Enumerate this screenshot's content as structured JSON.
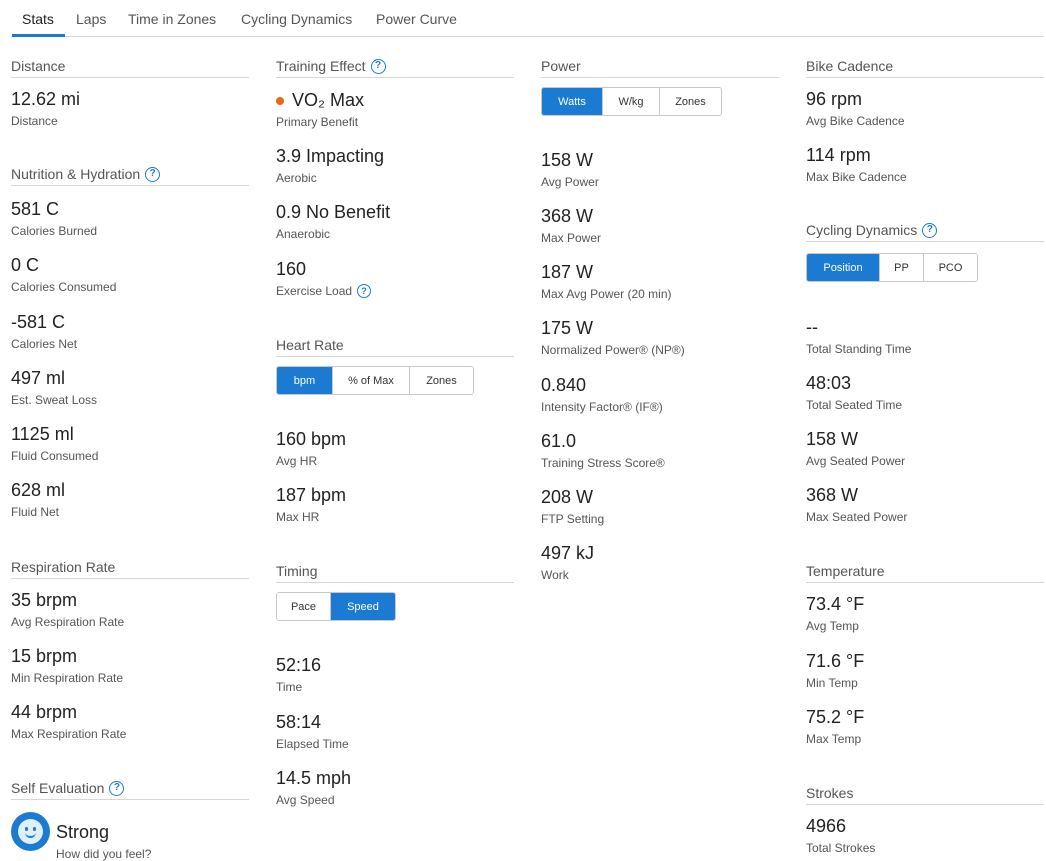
{
  "tabs": [
    "Stats",
    "Laps",
    "Time in Zones",
    "Cycling Dynamics",
    "Power Curve"
  ],
  "col1": {
    "distance": {
      "title": "Distance",
      "value": "12.62 mi",
      "label": "Distance"
    },
    "nutrition": {
      "title": "Nutrition & Hydration",
      "stats": [
        {
          "value": "581 C",
          "label": "Calories Burned"
        },
        {
          "value": "0 C",
          "label": "Calories Consumed"
        },
        {
          "value": "-581 C",
          "label": "Calories Net"
        },
        {
          "value": "497 ml",
          "label": "Est. Sweat Loss"
        },
        {
          "value": "1125 ml",
          "label": "Fluid Consumed"
        },
        {
          "value": "628 ml",
          "label": "Fluid Net"
        }
      ]
    },
    "respiration": {
      "title": "Respiration Rate",
      "stats": [
        {
          "value": "35 brpm",
          "label": "Avg Respiration Rate"
        },
        {
          "value": "15 brpm",
          "label": "Min Respiration Rate"
        },
        {
          "value": "44 brpm",
          "label": "Max Respiration Rate"
        }
      ]
    },
    "self_eval": {
      "title": "Self Evaluation",
      "value": "Strong",
      "label": "How did you feel?"
    }
  },
  "col2": {
    "training_effect": {
      "title": "Training Effect",
      "primary": {
        "value": "VO₂ Max",
        "label": "Primary Benefit"
      },
      "aerobic": {
        "value": "3.9 Impacting",
        "label": "Aerobic"
      },
      "anaerobic": {
        "value": "0.9 No Benefit",
        "label": "Anaerobic"
      },
      "load": {
        "value": "160",
        "label": "Exercise Load"
      }
    },
    "heart_rate": {
      "title": "Heart Rate",
      "toggle": [
        "bpm",
        "% of Max",
        "Zones"
      ],
      "avg": {
        "value": "160 bpm",
        "label": "Avg HR"
      },
      "max": {
        "value": "187 bpm",
        "label": "Max HR"
      }
    },
    "timing": {
      "title": "Timing",
      "toggle": [
        "Pace",
        "Speed"
      ],
      "stats": [
        {
          "value": "52:16",
          "label": "Time"
        },
        {
          "value": "58:14",
          "label": "Elapsed Time"
        },
        {
          "value": "14.5 mph",
          "label": "Avg Speed"
        }
      ]
    }
  },
  "col3": {
    "power": {
      "title": "Power",
      "toggle": [
        "Watts",
        "W/kg",
        "Zones"
      ],
      "stats": [
        {
          "value": "158 W",
          "label": "Avg Power"
        },
        {
          "value": "368 W",
          "label": "Max Power"
        },
        {
          "value": "187 W",
          "label": "Max Avg Power (20 min)"
        },
        {
          "value": "175 W",
          "label": "Normalized Power® (NP®)"
        },
        {
          "value": "0.840",
          "label": "Intensity Factor® (IF®)"
        },
        {
          "value": "61.0",
          "label": "Training Stress Score®"
        },
        {
          "value": "208 W",
          "label": "FTP Setting"
        },
        {
          "value": "497 kJ",
          "label": "Work"
        }
      ]
    }
  },
  "col4": {
    "cadence": {
      "title": "Bike Cadence",
      "stats": [
        {
          "value": "96 rpm",
          "label": "Avg Bike Cadence"
        },
        {
          "value": "114 rpm",
          "label": "Max Bike Cadence"
        }
      ]
    },
    "dynamics": {
      "title": "Cycling Dynamics",
      "toggle": [
        "Position",
        "PP",
        "PCO"
      ],
      "stats": [
        {
          "value": "--",
          "label": "Total Standing Time"
        },
        {
          "value": "48:03",
          "label": "Total Seated Time"
        },
        {
          "value": "158 W",
          "label": "Avg Seated Power"
        },
        {
          "value": "368 W",
          "label": "Max Seated Power"
        }
      ]
    },
    "temperature": {
      "title": "Temperature",
      "stats": [
        {
          "value": "73.4 °F",
          "label": "Avg Temp"
        },
        {
          "value": "71.6 °F",
          "label": "Min Temp"
        },
        {
          "value": "75.2 °F",
          "label": "Max Temp"
        }
      ]
    },
    "strokes": {
      "title": "Strokes",
      "value": "4966",
      "label": "Total Strokes"
    }
  },
  "colors": {
    "accent": "#1b7ad1",
    "benefit_dot": "#e86a14"
  },
  "icons": {
    "help": "question-circle-icon",
    "self_eval": "smiley-face-icon"
  }
}
